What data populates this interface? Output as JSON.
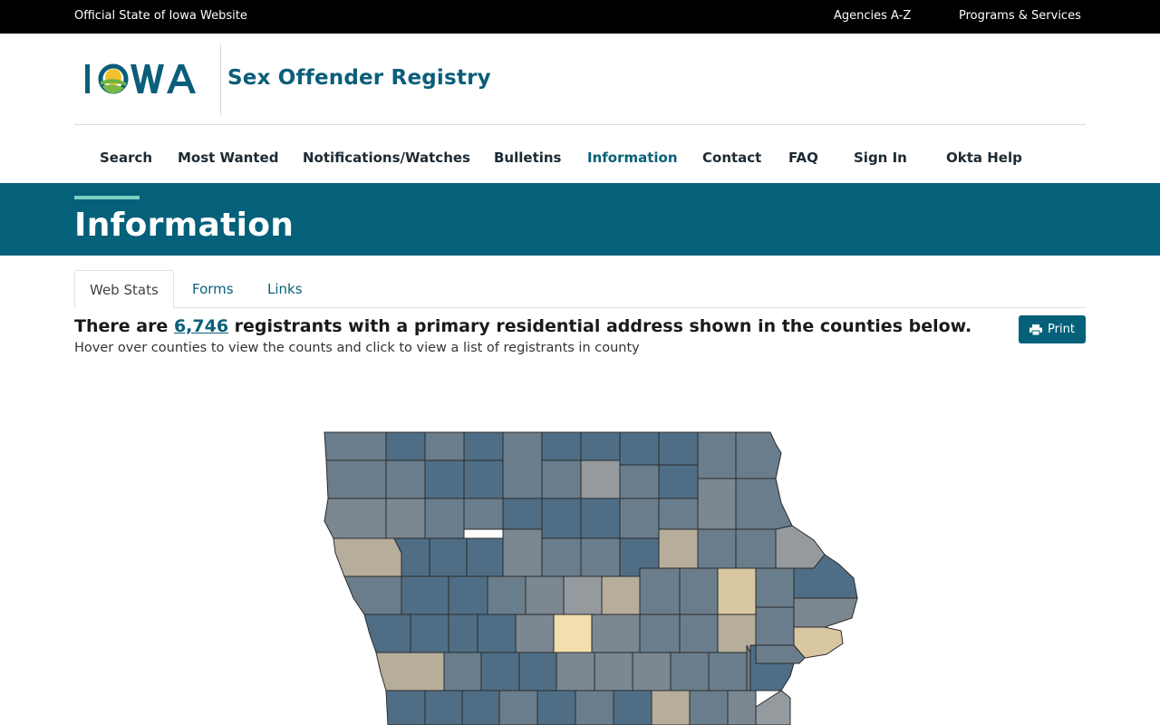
{
  "topbar": {
    "official": "Official State of Iowa Website",
    "agencies": "Agencies A-Z",
    "programs": "Programs & Services"
  },
  "header": {
    "logo_text": "IOWA",
    "site_title": "Sex Offender Registry"
  },
  "nav": [
    {
      "label": "Search"
    },
    {
      "label": "Most Wanted"
    },
    {
      "label": "Notifications/Watches"
    },
    {
      "label": "Bulletins"
    },
    {
      "label": "Information"
    },
    {
      "label": "Contact"
    },
    {
      "label": "FAQ"
    },
    {
      "label": "Sign In"
    },
    {
      "label": "Okta Help"
    }
  ],
  "banner": {
    "title": "Information"
  },
  "tabs": [
    {
      "label": "Web Stats"
    },
    {
      "label": "Forms"
    },
    {
      "label": "Links"
    }
  ],
  "stats": {
    "prefix": "There are ",
    "count": "6,746",
    "suffix": " registrants with a primary residential address shown in the counties below.",
    "hint": "Hover over counties to view the counts and click to view a list of registrants in county"
  },
  "print_label": "Print",
  "colors": {
    "brand": "#05607a",
    "nav_active": "#0b6078",
    "accent": "#7dd0c4",
    "map_dark": "#4f6e86",
    "map_slate": "#6a7d8c",
    "map_gray": "#7b8791",
    "map_lightgray": "#949a9e",
    "map_tan": "#b6ad9b",
    "map_beige": "#d9c7a2",
    "map_yellow": "#f2dfae"
  }
}
